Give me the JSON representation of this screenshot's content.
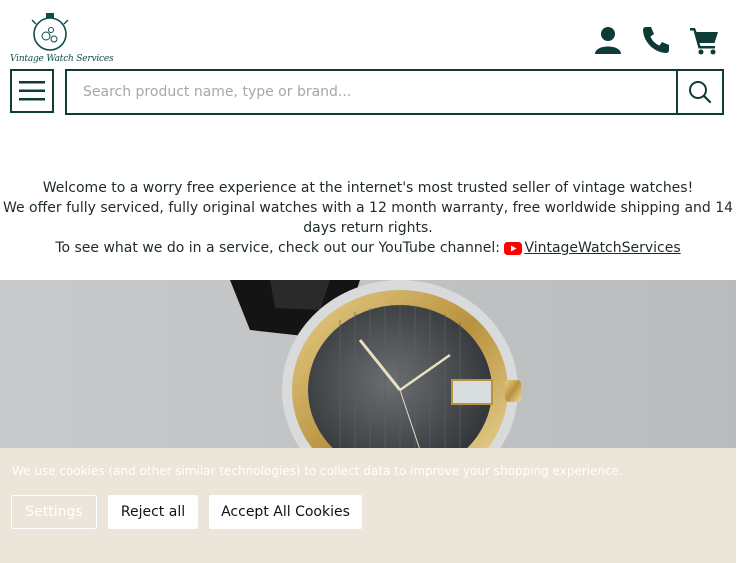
{
  "brand": {
    "name": "Vintage Watch Services"
  },
  "header": {
    "icons": [
      "account-icon",
      "phone-icon",
      "cart-icon"
    ]
  },
  "search": {
    "placeholder": "Search product name, type or brand..."
  },
  "welcome": {
    "line1": "Welcome to a worry free experience at the internet's most trusted seller of vintage watches!",
    "line2": "We offer fully serviced, fully original watches with a 12 month warranty, free worldwide shipping and 14 days return rights.",
    "line3": "To see what we do in a service, check out our YouTube channel:",
    "youtube_link": "VintageWatchServices"
  },
  "cookie_banner": {
    "message": "We use cookies (and other similar technologies) to collect data to improve your shopping experience.",
    "settings_label": "Settings",
    "reject_label": "Reject all",
    "accept_label": "Accept All Cookies"
  },
  "colors": {
    "brand_dark": "#0d3b38",
    "cookie_bg": "#ece5d9",
    "youtube_red": "#ff0000"
  }
}
